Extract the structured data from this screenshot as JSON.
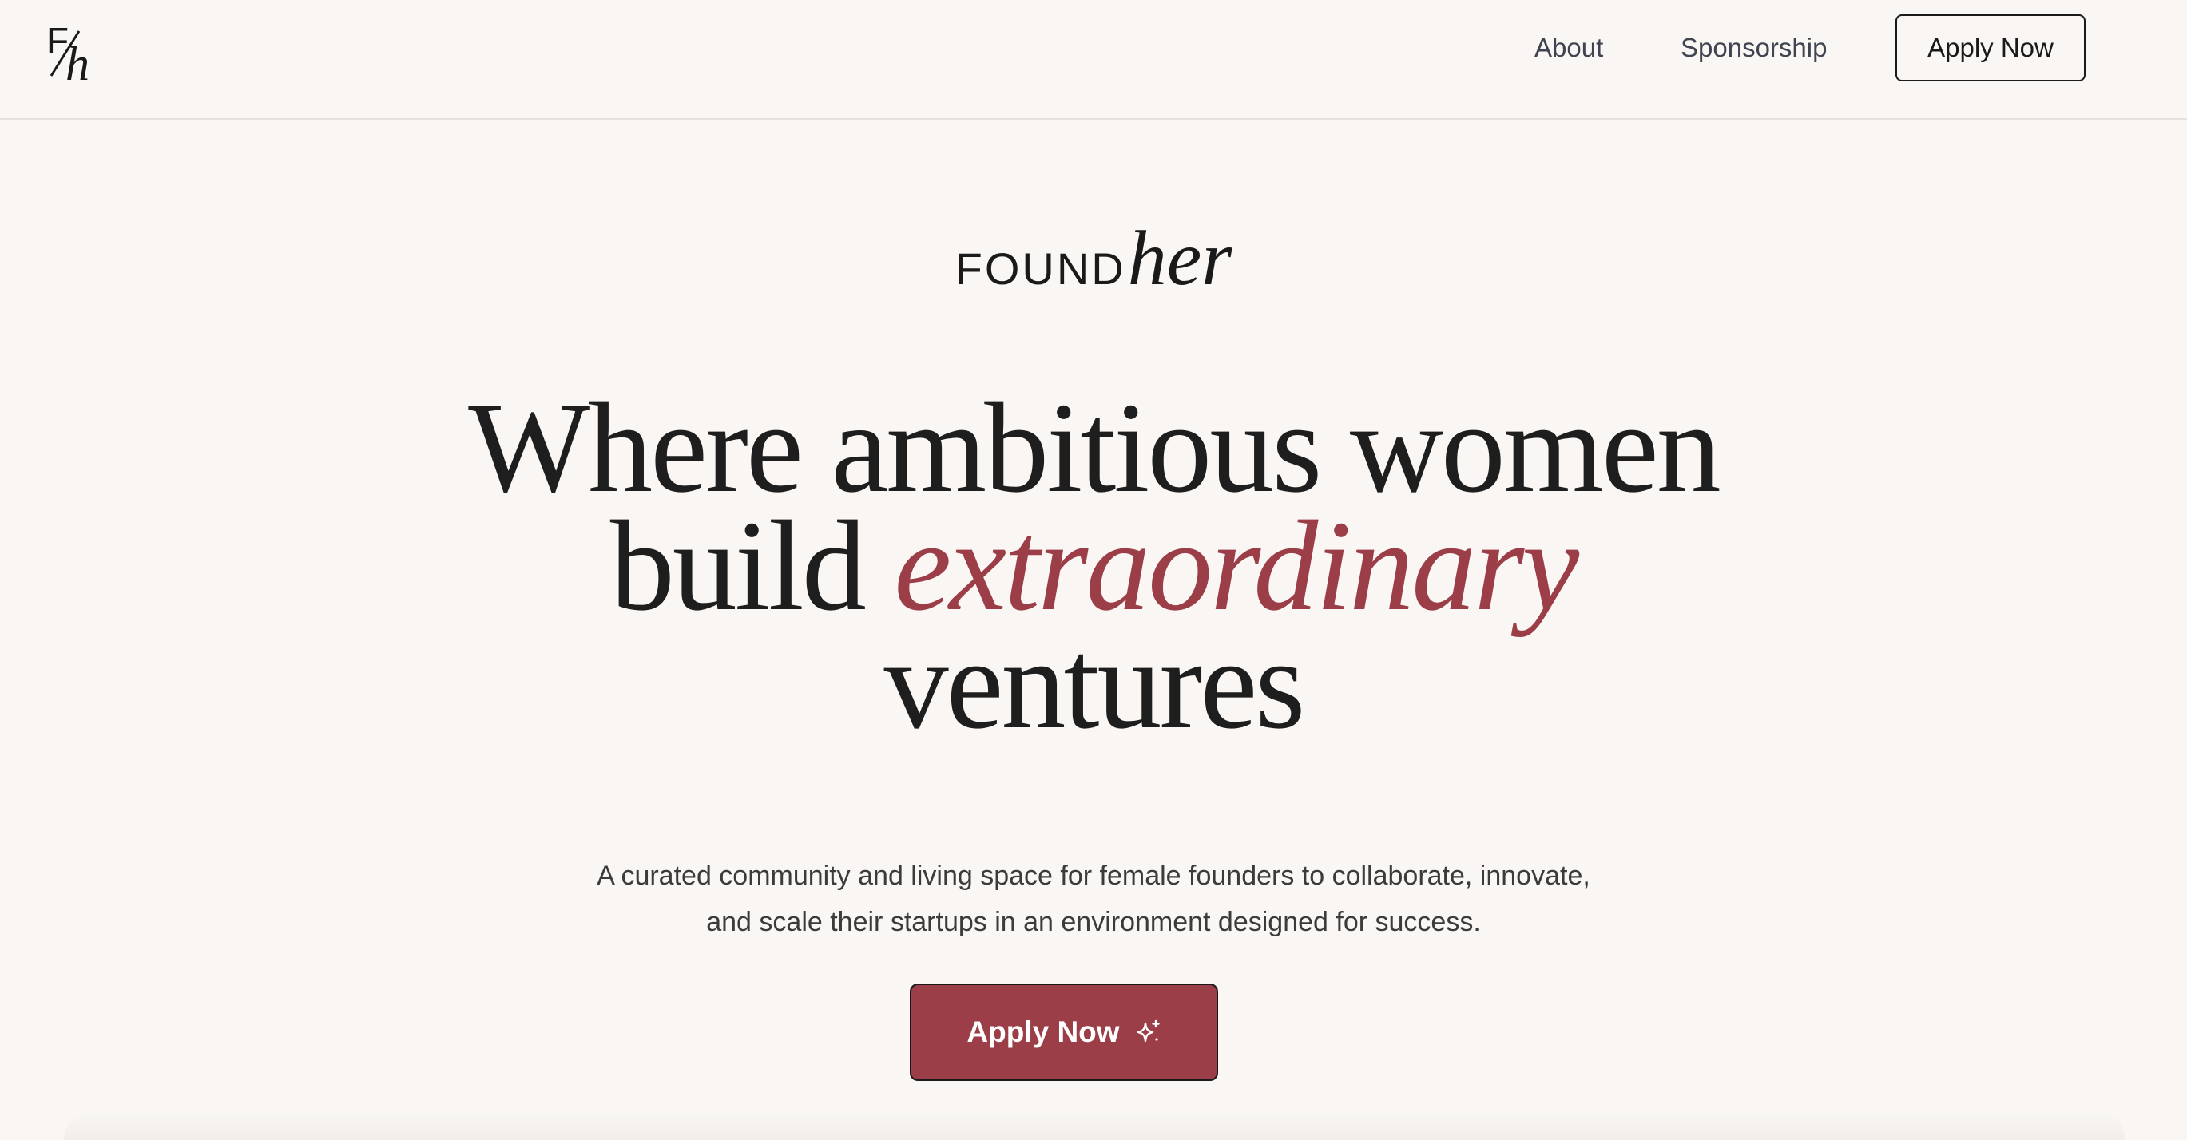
{
  "header": {
    "logo": {
      "letter_f": "F",
      "letter_h": "h",
      "icon": "fh-monogram-logo"
    },
    "nav": {
      "about_label": "About",
      "sponsorship_label": "Sponsorship",
      "apply_label": "Apply Now"
    }
  },
  "hero": {
    "brand": {
      "found": "FOUND",
      "her": "her"
    },
    "headline": {
      "line1": "Where ambitious women",
      "line2_start": "build ",
      "line2_accent": "extraordinary",
      "line3": "ventures"
    },
    "subtitle": {
      "line1": "A curated community and living space for female founders to collaborate, innovate,",
      "line2": "and scale their startups in an environment designed for success."
    },
    "cta": {
      "label": "Apply Now",
      "icon": "sparkle-icon"
    }
  },
  "colors": {
    "background": "#f9f6f3",
    "accent": "#9b3e48",
    "text_dark": "#1e1e1e",
    "nav_text": "#3f4450"
  }
}
